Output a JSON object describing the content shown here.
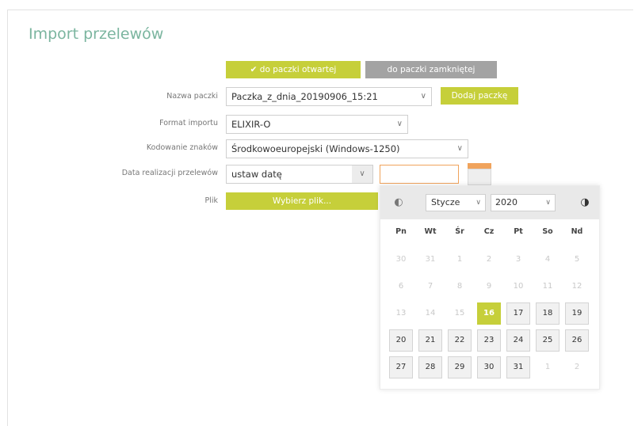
{
  "page": {
    "title": "Import przelewów"
  },
  "toggle": {
    "open_label": "✔ do paczki otwartej",
    "closed_label": "do paczki zamkniętej"
  },
  "form": {
    "package_name": {
      "label": "Nazwa paczki",
      "value": "Paczka_z_dnia_20190906_15:21",
      "add_label": "Dodaj paczkę"
    },
    "format": {
      "label": "Format importu",
      "value": "ELIXIR-O"
    },
    "encoding": {
      "label": "Kodowanie znaków",
      "value": "Środkowoeuropejski (Windows-1250)"
    },
    "date": {
      "label": "Data realizacji przelewów",
      "value": "ustaw datę",
      "input_value": ""
    },
    "file": {
      "label": "Plik",
      "button_label": "Wybierz plik..."
    }
  },
  "datepicker": {
    "month": "Stycze",
    "year": "2020",
    "weekdays": [
      "Pn",
      "Wt",
      "Śr",
      "Cz",
      "Pt",
      "So",
      "Nd"
    ],
    "weeks": [
      [
        {
          "d": "30",
          "s": "out"
        },
        {
          "d": "31",
          "s": "out"
        },
        {
          "d": "1",
          "s": "past"
        },
        {
          "d": "2",
          "s": "past"
        },
        {
          "d": "3",
          "s": "past"
        },
        {
          "d": "4",
          "s": "past"
        },
        {
          "d": "5",
          "s": "past"
        }
      ],
      [
        {
          "d": "6",
          "s": "past"
        },
        {
          "d": "7",
          "s": "past"
        },
        {
          "d": "8",
          "s": "past"
        },
        {
          "d": "9",
          "s": "past"
        },
        {
          "d": "10",
          "s": "past"
        },
        {
          "d": "11",
          "s": "past"
        },
        {
          "d": "12",
          "s": "past"
        }
      ],
      [
        {
          "d": "13",
          "s": "past"
        },
        {
          "d": "14",
          "s": "past"
        },
        {
          "d": "15",
          "s": "past"
        },
        {
          "d": "16",
          "s": "today"
        },
        {
          "d": "17",
          "s": "avail"
        },
        {
          "d": "18",
          "s": "avail"
        },
        {
          "d": "19",
          "s": "avail"
        }
      ],
      [
        {
          "d": "20",
          "s": "avail"
        },
        {
          "d": "21",
          "s": "avail"
        },
        {
          "d": "22",
          "s": "avail"
        },
        {
          "d": "23",
          "s": "avail"
        },
        {
          "d": "24",
          "s": "avail"
        },
        {
          "d": "25",
          "s": "avail"
        },
        {
          "d": "26",
          "s": "avail"
        }
      ],
      [
        {
          "d": "27",
          "s": "avail"
        },
        {
          "d": "28",
          "s": "avail"
        },
        {
          "d": "29",
          "s": "avail"
        },
        {
          "d": "30",
          "s": "avail"
        },
        {
          "d": "31",
          "s": "avail"
        },
        {
          "d": "1",
          "s": "out"
        },
        {
          "d": "2",
          "s": "out"
        }
      ]
    ]
  },
  "colors": {
    "accent": "#c6cf3a",
    "secondary": "#a3a3a3",
    "title": "#7bb59f",
    "focus": "#f0a35c"
  }
}
